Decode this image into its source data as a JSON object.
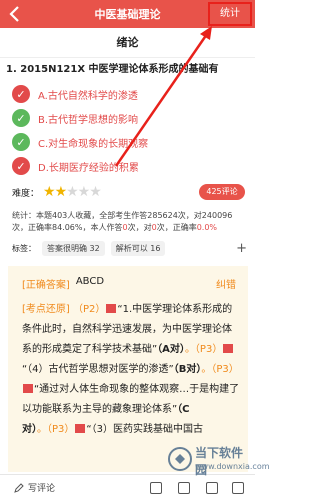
{
  "header": {
    "title": "中医基础理论",
    "stats_label": "统计"
  },
  "section_title": "绪论",
  "question": "1. 2015N121X 中医学理论体系形成的基础有",
  "options": [
    {
      "mark": "✓",
      "text": "A.古代自然科学的渗透",
      "status": "correct"
    },
    {
      "mark": "✓",
      "text": "B.古代哲学思想的影响",
      "status": "correct"
    },
    {
      "mark": "✓",
      "text": "C.对生命现象的长期观察",
      "status": "correct"
    },
    {
      "mark": "✓",
      "text": "D.长期医疗经验的积累",
      "status": "correct"
    }
  ],
  "difficulty": {
    "label": "难度：",
    "stars_filled": 2,
    "stars_total": 5
  },
  "comment_button": "425评论",
  "stats": {
    "line1": "统计：本题403人收藏，全部考生作答285624次，对240096",
    "line2_prefix": "次，正确率84.06%，本人作答",
    "count1": "0",
    "mid1": "次，对",
    "count2": "0",
    "mid2": "次，正确率",
    "rate": "0.0%"
  },
  "tags": {
    "label": "标签：",
    "items": [
      "答案很明确 32",
      "解析可以 16"
    ],
    "add": "+"
  },
  "answer": {
    "label": "[正确答案]",
    "value": "ABCD",
    "report": "纠错",
    "exam_label": "[考点还原]",
    "p2": "（P2）",
    "t1": "“1.中医学理论体系形成的条件此时，自然科学迅速发展，为中医学理论体系的形成奠定了科学技术基础”",
    "a1": "（A对）",
    "p3a": "。（P3）",
    "t2": "“（4）古代哲学思想对医学的渗透”",
    "a2": "（B对）",
    "p3b": "。（P3）",
    "t3": "“通过对人体生命现象的整体观察…于是构建了以功能联系为主导的藏象理论体系”",
    "a3": "（C对）",
    "p3c": "。（P3）",
    "t4": "“（3）医药实践基础中国古"
  },
  "bottom": {
    "write_comment": "写评论"
  },
  "watermark": {
    "name": "当下软件园",
    "sub": "www.downxia.com"
  },
  "colors": {
    "primary": "#e8534a",
    "correct": "#5cb85c",
    "accent": "#f08a1c"
  }
}
